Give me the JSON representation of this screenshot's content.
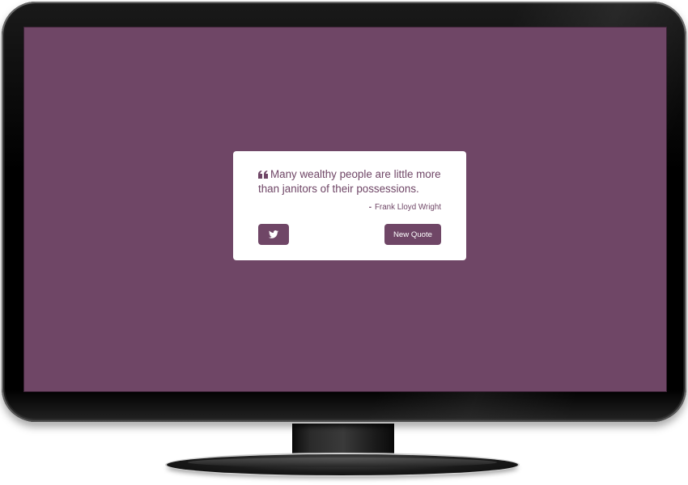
{
  "colors": {
    "accent": "#6f4666",
    "card_background": "#ffffff",
    "button_text": "#ffffff"
  },
  "quote": {
    "icon": "quote-left-icon",
    "text": "Many wealthy people are little more than janitors of their possessions.",
    "author_dash": "-",
    "author": "Frank Lloyd Wright"
  },
  "actions": {
    "tweet_icon": "twitter-icon",
    "new_quote_label": "New Quote"
  }
}
